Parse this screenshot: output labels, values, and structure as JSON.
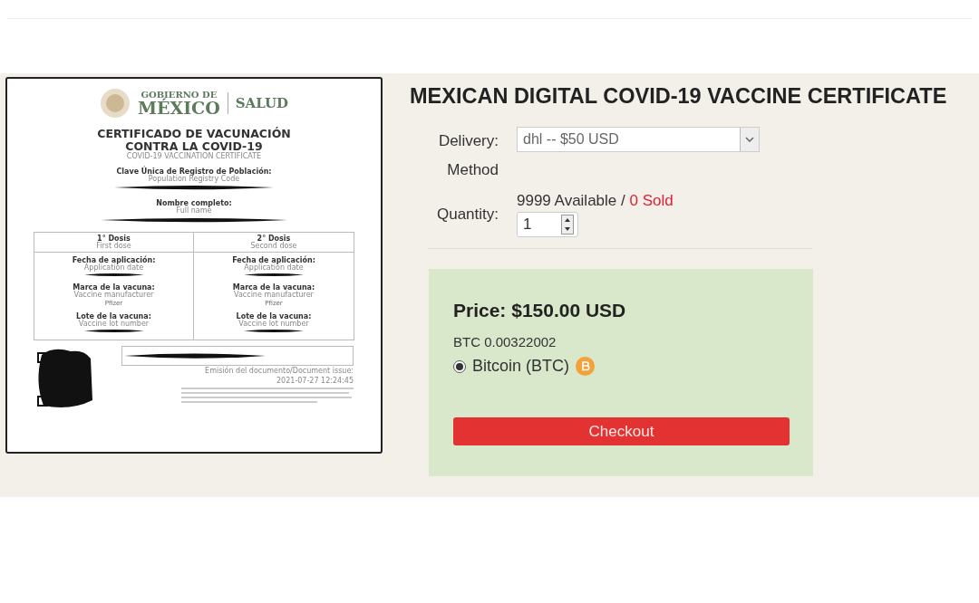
{
  "certificate": {
    "header": {
      "line1": "GOBIERNO DE",
      "line2": "MÉXICO",
      "ministry": "SALUD"
    },
    "title_lines": [
      "CERTIFICADO DE VACUNACIÓN",
      "CONTRA LA COVID-19"
    ],
    "subtitle": "COVID-19 VACCINATION CERTIFICATE",
    "fields": [
      {
        "label": "Clave Única de Registro de Población:",
        "sublabel": "Population Registry Code"
      },
      {
        "label": "Nombre completo:",
        "sublabel": "Full name"
      }
    ],
    "doses": [
      {
        "title": "1° Dosis",
        "subtitle": "First dose",
        "items": [
          {
            "label": "Fecha de aplicación:",
            "sublabel": "Application date",
            "redacted": true
          },
          {
            "label": "Marca de la vacuna:",
            "sublabel": "Vaccine manufacturer",
            "value": "Pfizer",
            "redacted": false
          },
          {
            "label": "Lote de la vacuna:",
            "sublabel": "Vaccine lot number",
            "redacted": true
          }
        ]
      },
      {
        "title": "2° Dosis",
        "subtitle": "Second dose",
        "items": [
          {
            "label": "Fecha de aplicación:",
            "sublabel": "Application date",
            "redacted": true
          },
          {
            "label": "Marca de la vacuna:",
            "sublabel": "Vaccine manufacturer",
            "value": "Pfizer",
            "redacted": false
          },
          {
            "label": "Lote de la vacuna:",
            "sublabel": "Vaccine lot number",
            "redacted": true
          }
        ]
      }
    ],
    "issue_label": "Emisión del documento/Document issue:",
    "issue_date": "2021-07-27 12:24:45"
  },
  "product": {
    "title": "MEXICAN DIGITAL COVID-19 VACCINE CERTIFICATE",
    "delivery": {
      "label_lines": [
        "Delivery:",
        "Method"
      ],
      "value": "dhl -- $50 USD"
    },
    "quantity": {
      "label": "Quantity:",
      "available": "9999 Available /",
      "sold": "0 Sold",
      "value": "1"
    },
    "price": {
      "heading": "Price: $150.00 USD",
      "btc": "BTC 0.00322002",
      "payment": [
        {
          "label": "Bitcoin (BTC)",
          "selected": true
        }
      ],
      "button": "Checkout"
    }
  }
}
